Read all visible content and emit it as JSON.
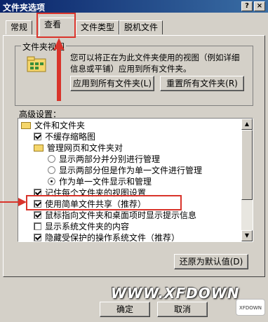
{
  "window": {
    "title": "文件夹选项",
    "help_label": "?",
    "close_label": "×"
  },
  "tabs": [
    {
      "label": "常规"
    },
    {
      "label": "查看"
    },
    {
      "label": "文件类型"
    },
    {
      "label": "脱机文件"
    }
  ],
  "folder_views": {
    "legend": "文件夹视图",
    "description": "您可以将正在为此文件夹使用的视图（例如详细信息或平铺）应用到所有文件夹。",
    "apply_all_label": "应用到所有文件夹(L)",
    "reset_all_label": "重置所有文件夹(R)"
  },
  "advanced": {
    "label": "高级设置：",
    "items": [
      {
        "label": "文件和文件夹",
        "kind": "folder"
      },
      {
        "label": "不缓存缩略图",
        "kind": "checkbox",
        "checked": true
      },
      {
        "label": "管理网页和文件夹对",
        "kind": "folder"
      },
      {
        "label": "显示两部分并分别进行管理",
        "kind": "radio",
        "selected": false
      },
      {
        "label": "显示两部分但是作为单一文件进行管理",
        "kind": "radio",
        "selected": false
      },
      {
        "label": "作为单一文件显示和管理",
        "kind": "radio",
        "selected": true
      },
      {
        "label": "记住每个文件夹的视图设置",
        "kind": "checkbox",
        "checked": true
      },
      {
        "label": "使用简单文件共享（推荐）",
        "kind": "checkbox",
        "checked": true
      },
      {
        "label": "鼠标指向文件夹和桌面项时显示提示信息",
        "kind": "checkbox",
        "checked": true
      },
      {
        "label": "显示系统文件夹的内容",
        "kind": "checkbox",
        "checked": false
      },
      {
        "label": "隐藏受保护的操作系统文件（推荐）",
        "kind": "checkbox",
        "checked": true
      }
    ],
    "restore_label": "还原为默认值(D)"
  },
  "footer": {
    "ok_label": "确定",
    "cancel_label": "取消"
  },
  "watermark": "WWW.XFDOWN",
  "logo_text": "XFDOWN",
  "colors": {
    "highlight": "#d9342b",
    "titlebar": "#0a246a"
  }
}
